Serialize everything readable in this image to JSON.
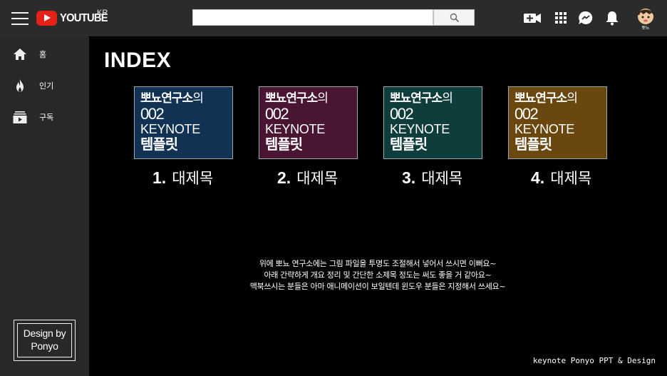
{
  "header": {
    "logo_text": "YOUTUBE",
    "logo_country": "KR",
    "search_value": "",
    "icons": [
      "menu-icon",
      "youtube-logo-icon",
      "search-icon",
      "upload-video-icon",
      "apps-grid-icon",
      "messages-icon",
      "notifications-bell-icon"
    ],
    "accent_color": "#e62117"
  },
  "sidebar": {
    "items": [
      {
        "label": "홈",
        "icon": "home-icon"
      },
      {
        "label": "인기",
        "icon": "trending-flame-icon"
      },
      {
        "label": "구독",
        "icon": "subscriptions-icon"
      }
    ],
    "design_by": {
      "line1": "Design by",
      "line2": "Ponyo",
      "apple_glyph": ""
    }
  },
  "main": {
    "title": "INDEX",
    "cards": [
      {
        "brand": "뽀뇨",
        "lab": "연구소",
        "suffix": "의",
        "number": "002",
        "keynote": "KEYNOTE",
        "template": "템플릿",
        "caption_num": "1.",
        "caption": "대제목",
        "bg": "#123253"
      },
      {
        "brand": "뽀뇨",
        "lab": "연구소",
        "suffix": "의",
        "number": "002",
        "keynote": "KEYNOTE",
        "template": "템플릿",
        "caption_num": "2.",
        "caption": "대제목",
        "bg": "#4a1533"
      },
      {
        "brand": "뽀뇨",
        "lab": "연구소",
        "suffix": "의",
        "number": "002",
        "keynote": "KEYNOTE",
        "template": "템플릿",
        "caption_num": "3.",
        "caption": "대제목",
        "bg": "#0f3d3c"
      },
      {
        "brand": "뽀뇨",
        "lab": "연구소",
        "suffix": "의",
        "number": "002",
        "keynote": "KEYNOTE",
        "template": "템플릿",
        "caption_num": "4.",
        "caption": "대제목",
        "bg": "#6b4710"
      }
    ],
    "note_lines": [
      "위에 뽀뇨 연구소에는 그림 파일을 투명도 조절해서 넣어서 쓰시면 이뻐요~",
      "아래 간략하게 개요 정리 및 간단한 소제목 정도는 써도 좋을 거 같아요~",
      "맥북쓰시는 분들은 아마 애니메이션이 보일텐데 윈도우 분들은 지정해서 쓰세요~"
    ],
    "footer_credit": "keynote Ponyo PPT & Design"
  }
}
